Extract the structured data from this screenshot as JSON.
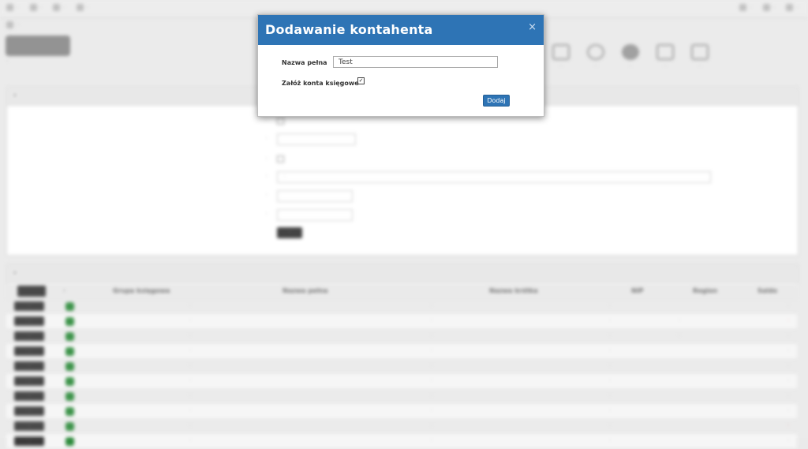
{
  "background": {
    "topbar_left": [
      "·",
      "·",
      "·",
      "·"
    ],
    "topbar_right": [
      "·",
      "·",
      "·"
    ],
    "breadcrumb": "·",
    "subtitle": "·",
    "toolbar": [
      "·",
      "·",
      "·",
      "·",
      "·"
    ],
    "filters": {
      "title": "·",
      "fields": [
        "·",
        "·",
        "·",
        "·",
        "·",
        "·"
      ],
      "search_button": "·",
      "select_value": "·"
    },
    "list": {
      "title": "·",
      "columns": [
        "·",
        "·",
        "Grupa księgowa",
        "Nazwa pełna",
        "Nazwa krótka",
        "NIP",
        "Region",
        "Saldo"
      ],
      "row_button": "·",
      "rows": [
        {
          "full": "·",
          "short": "·",
          "nip": "·",
          "region": "",
          "saldo": "·",
          "neg": false
        },
        {
          "full": "·",
          "short": "·",
          "nip": "·",
          "region": "·",
          "saldo": "·",
          "neg": true
        },
        {
          "full": "·",
          "short": "·",
          "nip": "·",
          "region": "·",
          "saldo": "·",
          "neg": false
        },
        {
          "full": "·",
          "short": "·",
          "nip": "·",
          "region": "",
          "saldo": "·",
          "neg": false
        },
        {
          "full": "·",
          "short": "·",
          "nip": "·",
          "region": "",
          "saldo": "·",
          "neg": false
        },
        {
          "full": "·",
          "short": "·",
          "nip": "·",
          "region": "",
          "saldo": "·",
          "neg": false
        },
        {
          "full": "·",
          "short": "·",
          "nip": "·",
          "region": "",
          "saldo": "·",
          "neg": false
        },
        {
          "full": "·",
          "short": "·",
          "nip": "·",
          "region": "",
          "saldo": "·",
          "neg": false
        },
        {
          "full": "·",
          "short": "·",
          "nip": "·",
          "region": "",
          "saldo": "·",
          "neg": true
        },
        {
          "full": "·",
          "short": "·",
          "nip": "·",
          "region": "",
          "saldo": "·",
          "neg": false
        }
      ]
    }
  },
  "modal": {
    "title": "Dodawanie kontahenta",
    "close_icon": "×",
    "name_label": "Nazwa pełna",
    "name_value": "Test",
    "accounts_label": "Załóż konta księgowe",
    "accounts_checked": true,
    "check_glyph": "✓",
    "add_button": "Dodaj"
  },
  "colors": {
    "modal_header": "#2e74b5",
    "status_green": "#2e8b3c",
    "negative_red": "#e05050"
  }
}
